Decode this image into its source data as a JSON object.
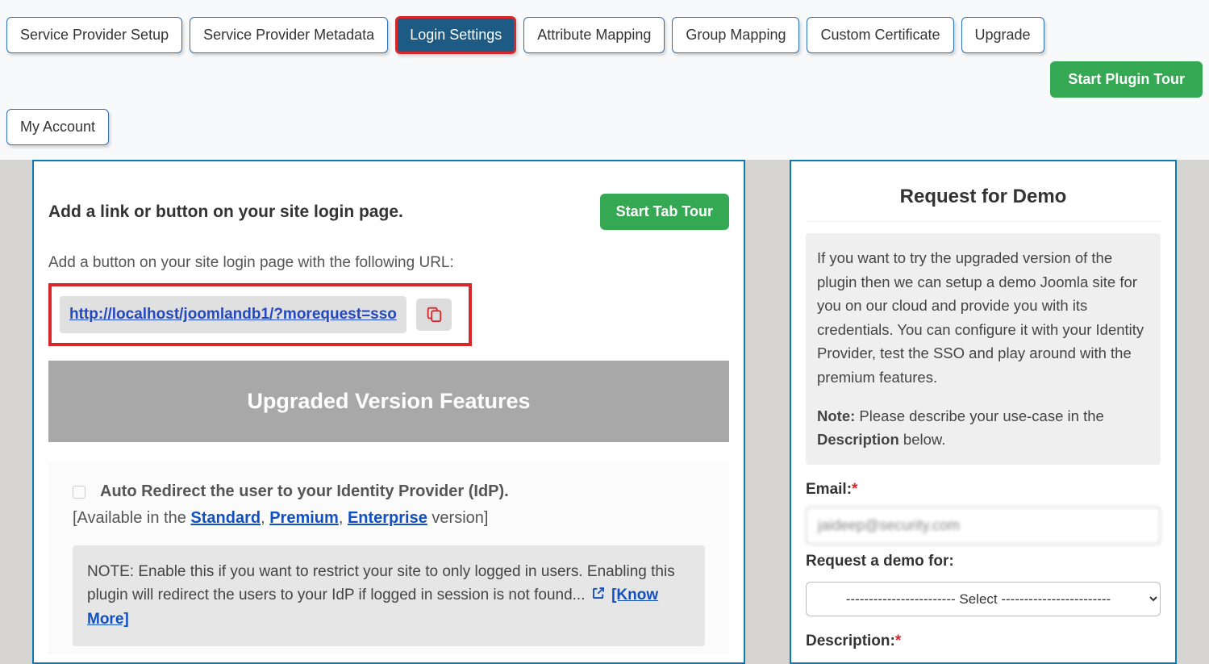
{
  "tabs": {
    "items": [
      {
        "label": "Service Provider Setup"
      },
      {
        "label": "Service Provider Metadata"
      },
      {
        "label": "Login Settings"
      },
      {
        "label": "Attribute Mapping"
      },
      {
        "label": "Group Mapping"
      },
      {
        "label": "Custom Certificate"
      },
      {
        "label": "Upgrade"
      }
    ],
    "row2": {
      "label": "My Account"
    },
    "active_index": 2
  },
  "plugin_tour_btn": "Start Plugin Tour",
  "main": {
    "title": "Add a link or button on your site login page.",
    "tab_tour_btn": "Start Tab Tour",
    "subtext": "Add a button on your site login page with the following URL:",
    "url": "http://localhost/joomlandb1/?morequest=sso",
    "banner": "Upgraded Version Features",
    "feature": {
      "title": "Auto Redirect the user to your Identity Provider (IdP).",
      "avail_prefix": "[Available in the ",
      "plan_standard": "Standard",
      "plan_premium": "Premium",
      "plan_enterprise": "Enterprise",
      "avail_suffix": " version]",
      "note_text": "NOTE: Enable this if you want to restrict your site to only logged in users. Enabling this plugin will redirect the users to your IdP if logged in session is not found...",
      "know_more": "[Know More]"
    }
  },
  "demo": {
    "title": "Request for Demo",
    "info": "If you want to try the upgraded version of the plugin then we can setup a demo Joomla site for you on our cloud and provide you with its credentials. You can configure it with your Identity Provider, test the SSO and play around with the premium features.",
    "note_label": "Note:",
    "note_text": " Please describe your use-case in the ",
    "note_bold": "Description",
    "note_suffix": " below.",
    "email_label": "Email:",
    "email_value": "jaideep@security.com",
    "req_for_label": "Request a demo for:",
    "select_option": "------------------------ Select ------------------------",
    "desc_label": "Description:"
  }
}
